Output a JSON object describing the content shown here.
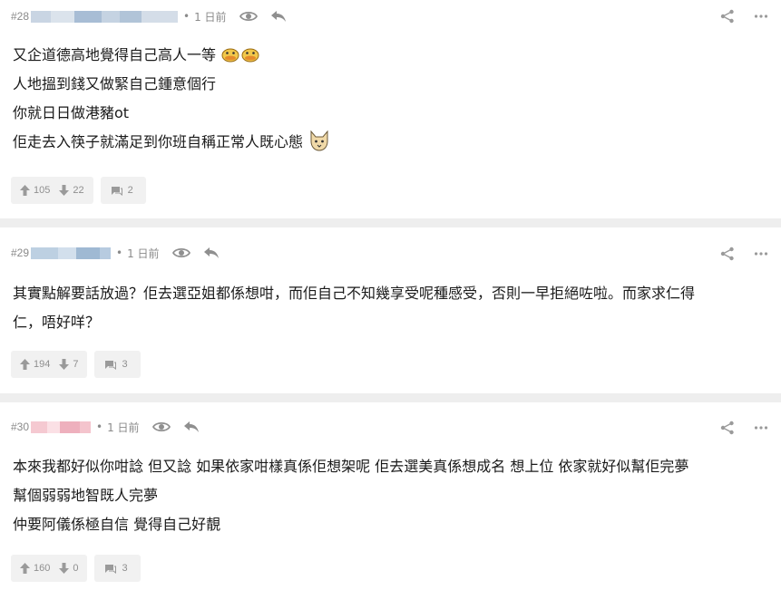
{
  "posts": [
    {
      "number": "#28",
      "separator": "•",
      "time": "1 日前",
      "username_colors": [
        "#c9d5e3",
        "#a8bdd5",
        "#c5d3e2",
        "#b1c4d8",
        "#d4dde8"
      ],
      "lines": [
        "又企道德高地覺得自己高人一等",
        "人地搵到錢又做緊自己鍾意個行",
        "你就日日做港豬ot",
        "佢走去入筷子就滿足到你班自稱正常人既心態"
      ],
      "upvotes": "105",
      "downvotes": "22",
      "comments": "2"
    },
    {
      "number": "#29",
      "separator": "•",
      "time": "1 日前",
      "username_colors": [
        "#bdd0e2",
        "#9fb9d3",
        "#b7cbe0"
      ],
      "lines": [
        "其實點解要話放過？佢去選亞姐都係想咁，而佢自己不知幾享受呢種感受，否則一早拒絕咗啦。而家求仁得",
        "仁，唔好咩？"
      ],
      "upvotes": "194",
      "downvotes": "7",
      "comments": "3"
    },
    {
      "number": "#30",
      "separator": "•",
      "time": "1 日前",
      "username_colors": [
        "#f5c9d1",
        "#eeb0bd",
        "#f4c4cd"
      ],
      "lines": [
        "本來我都好似你咁諗 但又諗 如果依家咁樣真係佢想架呢 佢去選美真係想成名 想上位 依家就好似幫佢完夢",
        "幫個弱弱地智既人完夢",
        "仲要阿儀係極自信 覺得自己好靚"
      ],
      "upvotes": "160",
      "downvotes": "0",
      "comments": "3"
    }
  ],
  "icons": {
    "view": "eye-icon",
    "reply": "reply-icon",
    "share": "share-icon",
    "more": "more-icon",
    "upvote": "thumb-up-arrow-icon",
    "downvote": "thumb-down-arrow-icon",
    "comment": "comment-bubble-icon"
  },
  "colors": {
    "meta_text": "#8a8a8a",
    "icon": "#9a9a9a",
    "button_bg": "#f1f1f1",
    "separator": "#eeeeee"
  }
}
